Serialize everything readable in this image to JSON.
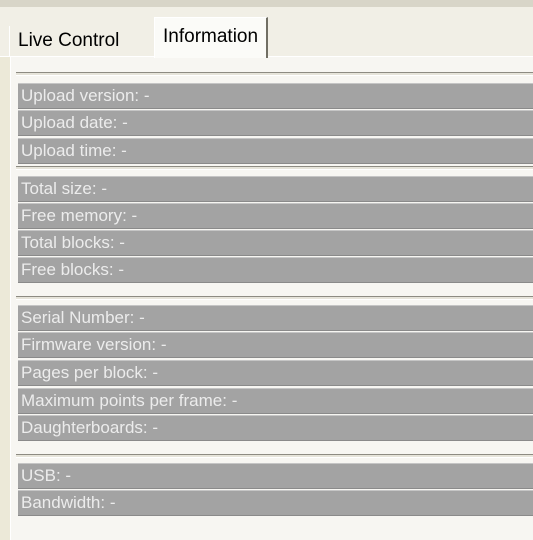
{
  "tabs": [
    {
      "label": "Live Control"
    },
    {
      "label": "Information"
    }
  ],
  "groups": [
    {
      "rows": [
        {
          "label": "Upload version:",
          "value": "-"
        },
        {
          "label": "Upload date:",
          "value": "-"
        },
        {
          "label": "Upload time:",
          "value": "-"
        }
      ]
    },
    {
      "rows": [
        {
          "label": "Total size:",
          "value": "-"
        },
        {
          "label": "Free memory:",
          "value": "-"
        },
        {
          "label": "Total blocks:",
          "value": "-"
        },
        {
          "label": "Free blocks:",
          "value": "-"
        }
      ]
    },
    {
      "rows": [
        {
          "label": "Serial Number:",
          "value": "-"
        },
        {
          "label": "Firmware version:",
          "value": "-"
        },
        {
          "label": "Pages per block:",
          "value": "-"
        },
        {
          "label": "Maximum points per frame:",
          "value": "-"
        },
        {
          "label": "Daughterboards:",
          "value": "-"
        }
      ]
    },
    {
      "rows": [
        {
          "label": "USB:",
          "value": "-"
        },
        {
          "label": "Bandwidth:",
          "value": "-"
        }
      ]
    }
  ]
}
